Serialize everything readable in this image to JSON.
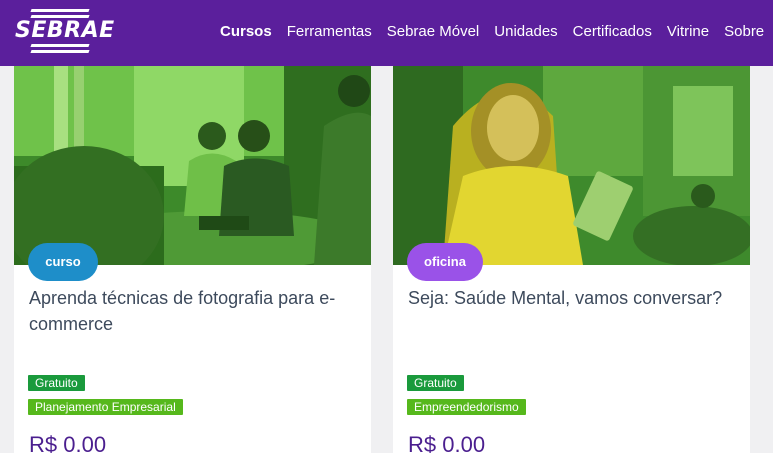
{
  "header": {
    "logo_text": "SEBRAE",
    "nav": [
      {
        "label": "Cursos",
        "active": true
      },
      {
        "label": "Ferramentas"
      },
      {
        "label": "Sebrae Móvel"
      },
      {
        "label": "Unidades"
      },
      {
        "label": "Certificados"
      },
      {
        "label": "Vitrine"
      },
      {
        "label": "Sobre"
      }
    ]
  },
  "cards": [
    {
      "type": "curso",
      "title": "Aprenda técnicas de fotografia para e-commerce",
      "tags": [
        "Gratuito",
        "Planejamento Empresarial"
      ],
      "price": "R$ 0.00"
    },
    {
      "type": "oficina",
      "title": "Seja: Saúde Mental, vamos conversar?",
      "tags": [
        "Gratuito",
        "Empreendedorismo"
      ],
      "price": "R$ 0.00"
    }
  ],
  "colors": {
    "header_bg": "#5b1f9c",
    "curso_badge": "#1e8ec9",
    "oficina_badge": "#9a52e8",
    "free_tag": "#1a9a3c",
    "topic_tag": "#56b81c",
    "price": "#4b1f8f",
    "image_tint": "#35b82c"
  }
}
